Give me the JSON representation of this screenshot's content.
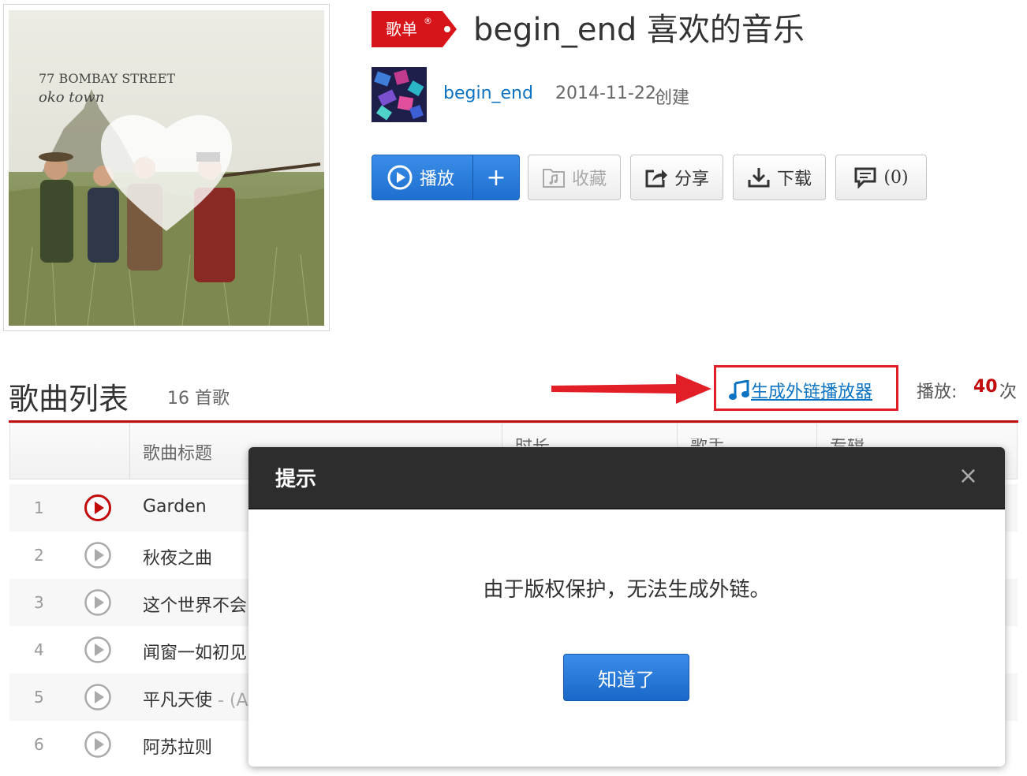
{
  "playlist": {
    "badge_label": "歌单",
    "badge_mark": "®",
    "title": "begin_end 喜欢的音乐",
    "creator": "begin_end",
    "create_date": "2014-11-22",
    "create_label": "创建",
    "cover_text_line1": "77 BOMBAY STREET",
    "cover_text_line2": "oko town"
  },
  "actions": {
    "play_label": "播放",
    "add_label": "+",
    "fav_label": "收藏",
    "share_label": "分享",
    "download_label": "下载",
    "comment_label": "(0)"
  },
  "songs_section": {
    "title": "歌曲列表",
    "count": "16 首歌",
    "external_player_link": "生成外链播放器",
    "play_count_label": "播放:",
    "play_count": "40",
    "play_count_unit": "次"
  },
  "table": {
    "col_title": "歌曲标题",
    "col_duration": "时长",
    "col_artist": "歌手",
    "col_album": "专辑",
    "rows": [
      {
        "num": "1",
        "name": "Garden",
        "tail": ""
      },
      {
        "num": "2",
        "name": "秋夜之曲",
        "tail": ""
      },
      {
        "num": "3",
        "name": "这个世界不会",
        "tail": ""
      },
      {
        "num": "4",
        "name": "闻窗一如初见",
        "tail": ""
      },
      {
        "num": "5",
        "name": "平凡天使",
        "tail": " - (A"
      },
      {
        "num": "6",
        "name": "阿苏拉则",
        "tail": ""
      }
    ]
  },
  "modal": {
    "title": "提示",
    "close_glyph": "×",
    "message": "由于版权保护，无法生成外链。",
    "ok_label": "知道了"
  },
  "colors": {
    "accent_blue": "#0c73c2",
    "brand_red": "#c20c0c",
    "highlight_red": "#e21f26",
    "modal_header": "#2d2d2d"
  }
}
